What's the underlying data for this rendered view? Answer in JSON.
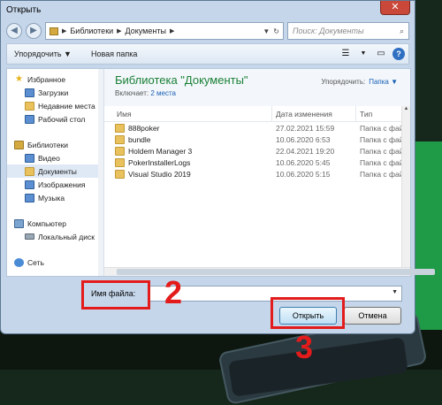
{
  "window": {
    "title": "Открыть"
  },
  "address": {
    "path": [
      "Библиотеки",
      "Документы"
    ],
    "search_placeholder": "Поиск: Документы"
  },
  "toolbar": {
    "organize": "Упорядочить ▼",
    "new_folder": "Новая папка"
  },
  "nav": {
    "favorites": "Избранное",
    "downloads": "Загрузки",
    "recent": "Недавние места",
    "desktop": "Рабочий стол",
    "libraries": "Библиотеки",
    "video": "Видео",
    "documents": "Документы",
    "images": "Изображения",
    "music": "Музыка",
    "computer": "Компьютер",
    "local_disk": "Локальный диск",
    "network": "Сеть"
  },
  "library": {
    "title": "Библиотека \"Документы\"",
    "includes": "Включает:",
    "places": "2 места",
    "arrange_label": "Упорядочить:",
    "arrange_value": "Папка"
  },
  "columns": {
    "name": "Имя",
    "date": "Дата изменения",
    "type": "Тип"
  },
  "files": [
    {
      "name": "888poker",
      "date": "27.02.2021 15:59",
      "type": "Папка с файл"
    },
    {
      "name": "bundle",
      "date": "10.06.2020 6:53",
      "type": "Папка с файл"
    },
    {
      "name": "Holdem Manager 3",
      "date": "22.04.2021 19:20",
      "type": "Папка с файл"
    },
    {
      "name": "PokerInstallerLogs",
      "date": "10.06.2020 5:45",
      "type": "Папка с файл"
    },
    {
      "name": "Visual Studio 2019",
      "date": "10.06.2020 5:15",
      "type": "Папка с файл"
    }
  ],
  "filename": {
    "label": "Имя файла:",
    "value": ""
  },
  "buttons": {
    "open": "Открыть",
    "cancel": "Отмена"
  },
  "annotations": {
    "step2": "2",
    "step3": "3"
  },
  "colors": {
    "accent_red": "#e31b1b",
    "title_green": "#1a7f35"
  }
}
